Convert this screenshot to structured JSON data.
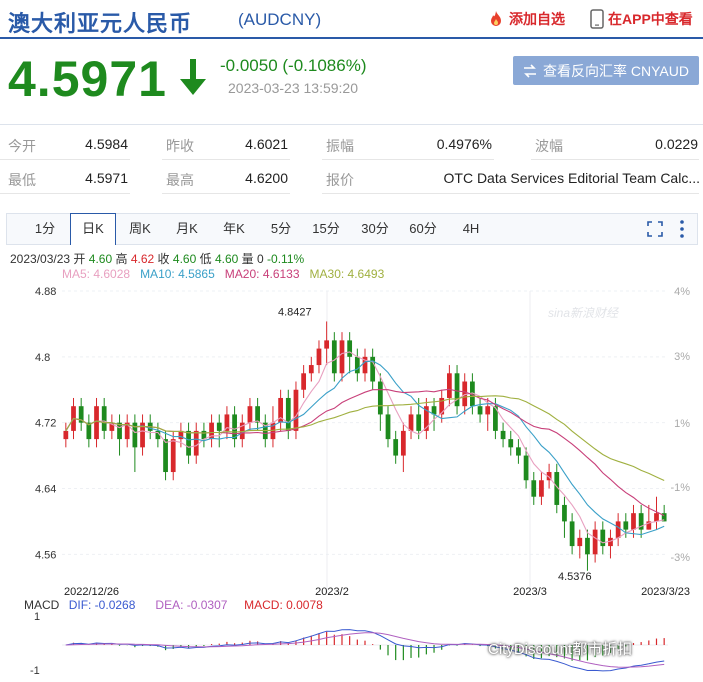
{
  "header": {
    "title": "澳大利亚元人民币",
    "code": "(AUDCNY)",
    "add_favorite": "添加自选",
    "view_in_app": "在APP中查看"
  },
  "quote": {
    "price": "4.5971",
    "change": "-0.0050 (-0.1086%)",
    "timestamp": "2023-03-23 13:59:20",
    "reverse_button": "查看反向汇率 CNYAUD"
  },
  "stats": [
    {
      "label": "今开",
      "value": "4.5984"
    },
    {
      "label": "昨收",
      "value": "4.6021"
    },
    {
      "label": "振幅",
      "value": "0.4976%"
    },
    {
      "label": "波幅",
      "value": "0.0229"
    },
    {
      "label": "最低",
      "value": "4.5971"
    },
    {
      "label": "最高",
      "value": "4.6200"
    },
    {
      "label": "报价",
      "value": "OTC Data Services Editorial Team Calc..."
    }
  ],
  "tabs": [
    "1分",
    "日K",
    "周K",
    "月K",
    "年K",
    "5分",
    "15分",
    "30分",
    "60分",
    "4H"
  ],
  "active_tab": "日K",
  "ohlc": {
    "date": "2023/03/23",
    "open_label": "开",
    "open": "4.60",
    "high_label": "高",
    "high": "4.62",
    "close_label": "收",
    "close": "4.60",
    "low_label": "低",
    "low": "4.60",
    "vol_label": "量",
    "vol": "0",
    "pct": "-0.11%"
  },
  "ma": {
    "ma5": "MA5: 4.6028",
    "ma10": "MA10: 4.5865",
    "ma20": "MA20: 4.6133",
    "ma30": "MA30: 4.6493"
  },
  "colors": {
    "up": "#d8282c",
    "down": "#1e8a1e",
    "ma5": "#e8a0c0",
    "ma10": "#3aa0c8",
    "ma20": "#c8407a",
    "ma30": "#a0b040",
    "brand": "#2a5aa8"
  },
  "chart_data": {
    "type": "candlestick",
    "y_ticks": [
      "4.88",
      "4.8",
      "4.72",
      "4.64",
      "4.56"
    ],
    "y_ticks_right": [
      "4%",
      "3%",
      "1%",
      "-1%",
      "-3%"
    ],
    "x_labels": [
      "2022/12/26",
      "2023/2",
      "2023/3",
      "2023/3/23"
    ],
    "annotations": {
      "high": "4.8427",
      "low": "4.5376"
    },
    "watermark": "sina新浪财经",
    "candles": [
      [
        4.7,
        4.71,
        4.69,
        4.72
      ],
      [
        4.71,
        4.74,
        4.7,
        4.75
      ],
      [
        4.74,
        4.72,
        4.71,
        4.75
      ],
      [
        4.72,
        4.7,
        4.69,
        4.73
      ],
      [
        4.7,
        4.74,
        4.69,
        4.75
      ],
      [
        4.74,
        4.71,
        4.7,
        4.75
      ],
      [
        4.71,
        4.72,
        4.7,
        4.73
      ],
      [
        4.72,
        4.7,
        4.68,
        4.73
      ],
      [
        4.7,
        4.72,
        4.69,
        4.73
      ],
      [
        4.72,
        4.69,
        4.66,
        4.73
      ],
      [
        4.69,
        4.72,
        4.68,
        4.73
      ],
      [
        4.72,
        4.71,
        4.7,
        4.73
      ],
      [
        4.71,
        4.7,
        4.69,
        4.72
      ],
      [
        4.7,
        4.66,
        4.65,
        4.71
      ],
      [
        4.66,
        4.7,
        4.65,
        4.71
      ],
      [
        4.7,
        4.71,
        4.69,
        4.72
      ],
      [
        4.71,
        4.68,
        4.67,
        4.72
      ],
      [
        4.68,
        4.71,
        4.67,
        4.72
      ],
      [
        4.71,
        4.7,
        4.69,
        4.72
      ],
      [
        4.7,
        4.72,
        4.69,
        4.73
      ],
      [
        4.72,
        4.71,
        4.69,
        4.73
      ],
      [
        4.71,
        4.73,
        4.7,
        4.74
      ],
      [
        4.73,
        4.7,
        4.69,
        4.74
      ],
      [
        4.7,
        4.72,
        4.69,
        4.73
      ],
      [
        4.72,
        4.74,
        4.71,
        4.75
      ],
      [
        4.74,
        4.72,
        4.71,
        4.75
      ],
      [
        4.72,
        4.7,
        4.69,
        4.73
      ],
      [
        4.7,
        4.72,
        4.69,
        4.74
      ],
      [
        4.72,
        4.75,
        4.71,
        4.76
      ],
      [
        4.75,
        4.71,
        4.7,
        4.76
      ],
      [
        4.71,
        4.76,
        4.7,
        4.77
      ],
      [
        4.76,
        4.78,
        4.75,
        4.79
      ],
      [
        4.78,
        4.79,
        4.77,
        4.8
      ],
      [
        4.79,
        4.81,
        4.78,
        4.82
      ],
      [
        4.81,
        4.82,
        4.79,
        4.843
      ],
      [
        4.82,
        4.78,
        4.77,
        4.83
      ],
      [
        4.78,
        4.82,
        4.77,
        4.83
      ],
      [
        4.82,
        4.8,
        4.78,
        4.83
      ],
      [
        4.8,
        4.78,
        4.77,
        4.81
      ],
      [
        4.78,
        4.8,
        4.77,
        4.81
      ],
      [
        4.8,
        4.77,
        4.76,
        4.81
      ],
      [
        4.77,
        4.73,
        4.71,
        4.78
      ],
      [
        4.73,
        4.7,
        4.69,
        4.74
      ],
      [
        4.7,
        4.68,
        4.67,
        4.71
      ],
      [
        4.68,
        4.71,
        4.66,
        4.72
      ],
      [
        4.71,
        4.73,
        4.7,
        4.74
      ],
      [
        4.73,
        4.71,
        4.7,
        4.75
      ],
      [
        4.71,
        4.74,
        4.7,
        4.75
      ],
      [
        4.74,
        4.73,
        4.71,
        4.75
      ],
      [
        4.73,
        4.75,
        4.72,
        4.76
      ],
      [
        4.75,
        4.78,
        4.74,
        4.79
      ],
      [
        4.78,
        4.74,
        4.73,
        4.79
      ],
      [
        4.74,
        4.77,
        4.73,
        4.78
      ],
      [
        4.77,
        4.74,
        4.73,
        4.78
      ],
      [
        4.74,
        4.73,
        4.72,
        4.75
      ],
      [
        4.73,
        4.74,
        4.71,
        4.75
      ],
      [
        4.74,
        4.71,
        4.7,
        4.75
      ],
      [
        4.71,
        4.7,
        4.69,
        4.72
      ],
      [
        4.7,
        4.69,
        4.68,
        4.71
      ],
      [
        4.69,
        4.68,
        4.67,
        4.7
      ],
      [
        4.68,
        4.65,
        4.64,
        4.69
      ],
      [
        4.65,
        4.63,
        4.62,
        4.66
      ],
      [
        4.63,
        4.65,
        4.62,
        4.66
      ],
      [
        4.65,
        4.66,
        4.64,
        4.67
      ],
      [
        4.66,
        4.62,
        4.61,
        4.67
      ],
      [
        4.62,
        4.6,
        4.58,
        4.63
      ],
      [
        4.6,
        4.57,
        4.56,
        4.61
      ],
      [
        4.57,
        4.58,
        4.555,
        4.59
      ],
      [
        4.58,
        4.56,
        4.54,
        4.59
      ],
      [
        4.56,
        4.59,
        4.55,
        4.6
      ],
      [
        4.59,
        4.57,
        4.56,
        4.6
      ],
      [
        4.57,
        4.58,
        4.555,
        4.59
      ],
      [
        4.58,
        4.6,
        4.57,
        4.61
      ],
      [
        4.6,
        4.59,
        4.58,
        4.61
      ],
      [
        4.59,
        4.61,
        4.58,
        4.62
      ],
      [
        4.61,
        4.59,
        4.58,
        4.62
      ],
      [
        4.59,
        4.6,
        4.59,
        4.62
      ],
      [
        4.6,
        4.61,
        4.59,
        4.63
      ],
      [
        4.61,
        4.6,
        4.6,
        4.62
      ]
    ]
  },
  "macd": {
    "label": "MACD",
    "dif": "DIF: -0.0268",
    "dea": "DEA: -0.0307",
    "macd": "MACD: 0.0078",
    "y_ticks": [
      "1",
      "-1"
    ]
  },
  "watermark_text": "CityDiscount都市折扣"
}
